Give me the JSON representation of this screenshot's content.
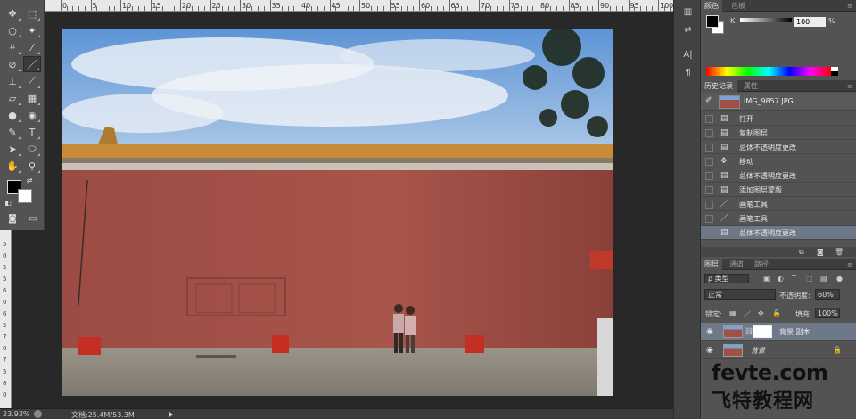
{
  "ruler_top": {
    "marks": [
      "0",
      "5",
      "10",
      "15",
      "20",
      "25",
      "30",
      "35",
      "40",
      "45",
      "50",
      "55",
      "60",
      "65",
      "70",
      "75",
      "80",
      "85",
      "90",
      "95",
      "100"
    ]
  },
  "ruler_left": {
    "marks": [
      "5",
      "0",
      "5",
      "5",
      "6",
      "0",
      "6",
      "5",
      "7",
      "0",
      "7",
      "5",
      "8",
      "0"
    ]
  },
  "toolbar": {
    "tools": [
      {
        "name": "move-tool-icon",
        "glyph": "✥"
      },
      {
        "name": "marquee-tool-icon",
        "glyph": "⬚"
      },
      {
        "name": "lasso-tool-icon",
        "glyph": "○"
      },
      {
        "name": "magic-wand-tool-icon",
        "glyph": "✦"
      },
      {
        "name": "crop-tool-icon",
        "glyph": "⌗"
      },
      {
        "name": "eyedropper-tool-icon",
        "glyph": "⁄"
      },
      {
        "name": "healing-brush-tool-icon",
        "glyph": "⊘"
      },
      {
        "name": "brush-tool-icon",
        "glyph": "／"
      },
      {
        "name": "clone-stamp-tool-icon",
        "glyph": "⊥"
      },
      {
        "name": "history-brush-tool-icon",
        "glyph": "⟋"
      },
      {
        "name": "eraser-tool-icon",
        "glyph": "▱"
      },
      {
        "name": "gradient-tool-icon",
        "glyph": "▦"
      },
      {
        "name": "blur-tool-icon",
        "glyph": "●"
      },
      {
        "name": "dodge-tool-icon",
        "glyph": "◉"
      },
      {
        "name": "pen-tool-icon",
        "glyph": "✎"
      },
      {
        "name": "type-tool-icon",
        "glyph": "T"
      },
      {
        "name": "path-selection-tool-icon",
        "glyph": "➤"
      },
      {
        "name": "ellipse-tool-icon",
        "glyph": "⬭"
      },
      {
        "name": "hand-tool-icon",
        "glyph": "✋"
      },
      {
        "name": "zoom-tool-icon",
        "glyph": "⚲"
      }
    ]
  },
  "statusbar": {
    "zoom": "23.93%",
    "doc": "文档:25.4M/53.3M"
  },
  "color_panel": {
    "tabs": [
      "颜色",
      "色板"
    ],
    "channel_label": "K",
    "channel_value": "100",
    "channel_unit": "%"
  },
  "history_panel": {
    "tabs": [
      "历史记录",
      "属性"
    ],
    "snapshot": "IMG_9857.JPG",
    "items": [
      {
        "label": "打开",
        "icon": "▤"
      },
      {
        "label": "复制图层",
        "icon": "▤"
      },
      {
        "label": "总体不透明度更改",
        "icon": "▤"
      },
      {
        "label": "移动",
        "icon": "✥"
      },
      {
        "label": "总体不透明度更改",
        "icon": "▤"
      },
      {
        "label": "添加图层蒙版",
        "icon": "▤"
      },
      {
        "label": "画笔工具",
        "icon": "／"
      },
      {
        "label": "画笔工具",
        "icon": "／"
      },
      {
        "label": "总体不透明度更改",
        "icon": "▤"
      }
    ]
  },
  "layers_panel": {
    "tabs": [
      "图层",
      "通道",
      "路径"
    ],
    "kind_filter": "ρ 类型",
    "blend_mode": "正常",
    "opacity_label": "不透明度:",
    "opacity_value": "60%",
    "lock_label": "锁定:",
    "fill_label": "填充:",
    "fill_value": "100%",
    "layers": [
      {
        "name": "背景 副本",
        "has_mask": true,
        "locked": false
      },
      {
        "name": "背景",
        "has_mask": false,
        "locked": true
      }
    ]
  },
  "watermark": {
    "en": "fevte.com",
    "cn": "飞特教程网"
  },
  "colors": {
    "panel_bg": "#535353",
    "selection": "#6d7888",
    "wall": "#a05045",
    "sky": "#6da0d8"
  }
}
